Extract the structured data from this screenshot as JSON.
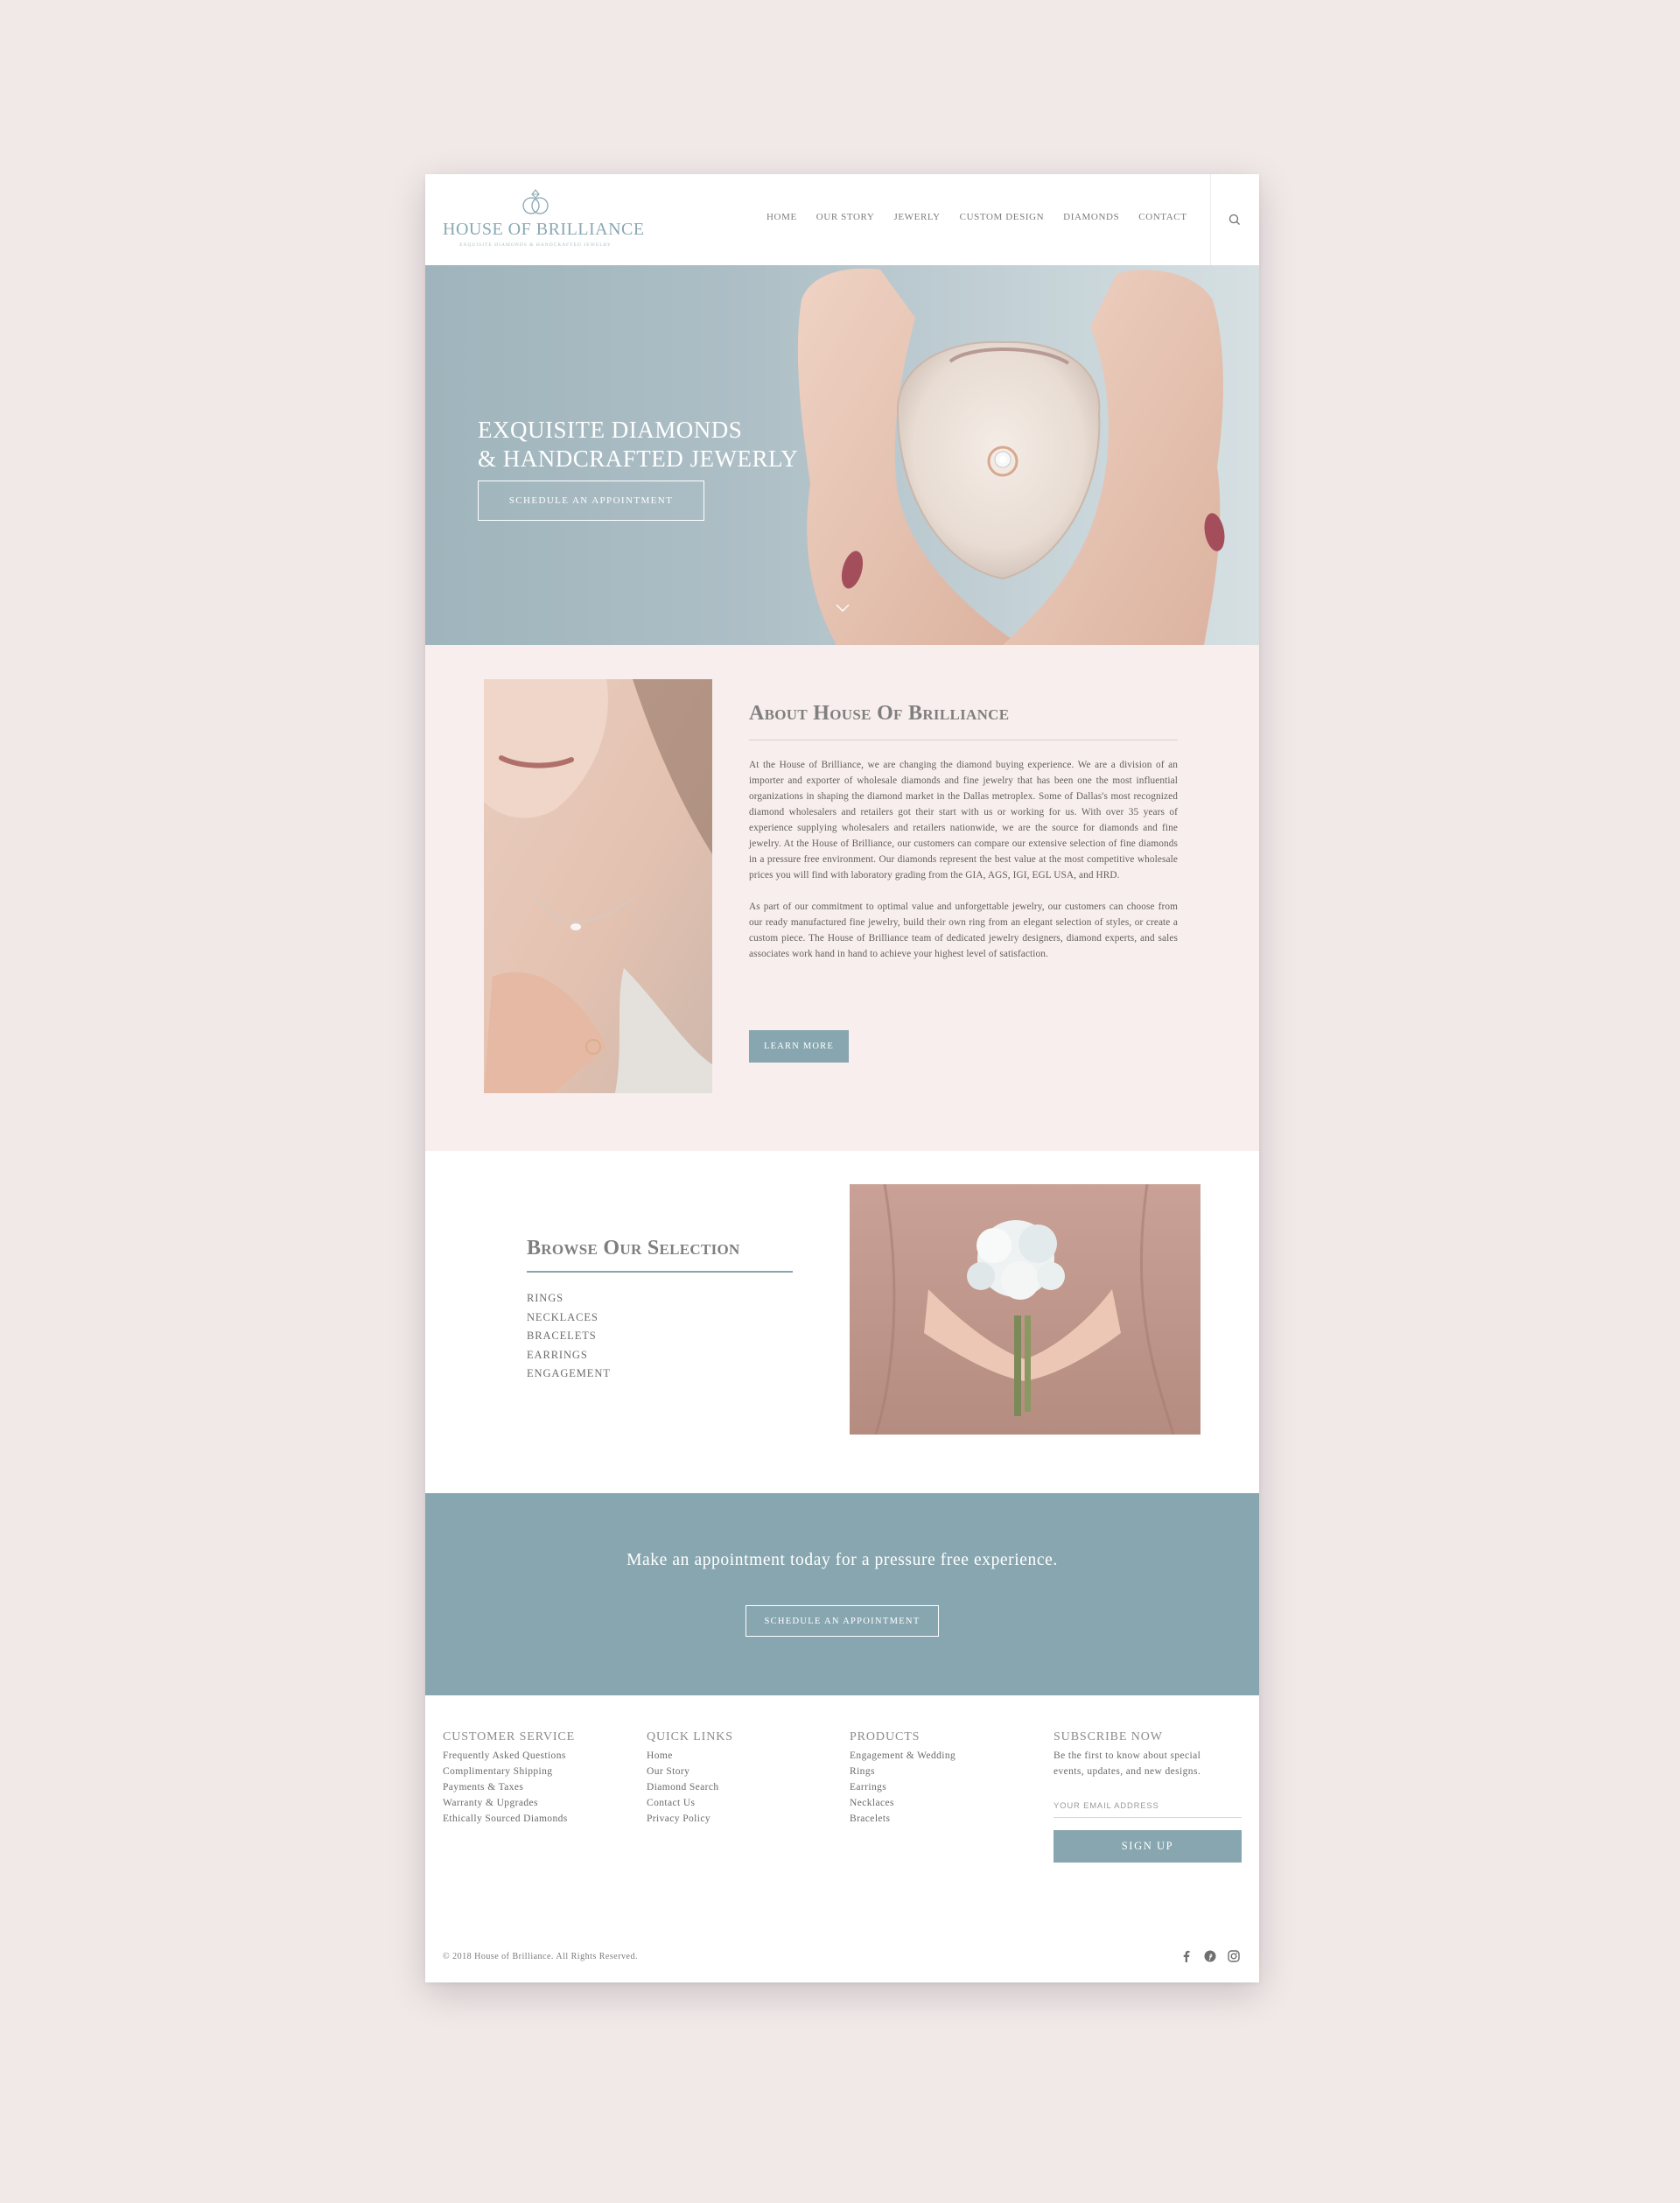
{
  "brand": {
    "name": "House of Brilliance",
    "tagline": "Exquisite Diamonds & Handcrafted Jewelry",
    "accent_color": "#87a6b0",
    "blush_color": "#f8eeed"
  },
  "nav": {
    "items": [
      "HOME",
      "OUR STORY",
      "JEWERLY",
      "CUSTOM DESIGN",
      "DIAMONDS",
      "CONTACT"
    ],
    "search_icon": "search-icon"
  },
  "hero": {
    "title_line1": "Exquisite Diamonds",
    "title_line2": "& Handcrafted Jewerly",
    "button": "Schedule an Appointment",
    "scroll_icon": "chevron-down-icon"
  },
  "about": {
    "title": "About House Of Brilliance",
    "paragraph1": "At the House of Brilliance, we are changing the diamond buying experience. We are a division of an importer and exporter of wholesale diamonds and fine jewelry that has been one the most influential organizations in shaping the diamond market in the Dallas metroplex. Some of Dallas's most recognized diamond wholesalers and retailers got their start with us or working for us. With over 35 years of experience supplying wholesalers and retailers nationwide, we are the source for diamonds and fine jewelry. At the House of Brilliance, our customers can compare our extensive selection of fine diamonds in a pressure free environment. Our diamonds represent the best value at the most competitive wholesale prices you will find with laboratory grading from the GIA, AGS, IGI, EGL USA, and HRD.",
    "paragraph2": "As part of our commitment to optimal value and unforgettable jewelry, our customers can choose from our ready manufactured fine jewelry, build their own ring from an elegant selection of styles, or create a custom piece. The House of Brilliance team of dedicated jewelry designers, diamond experts, and sales associates work hand in hand to achieve your highest level of satisfaction.",
    "button": "Learn More"
  },
  "browse": {
    "title": "Browse Our Selection",
    "items": [
      "Rings",
      "Necklaces",
      "Bracelets",
      "Earrings",
      "Engagement"
    ]
  },
  "cta": {
    "text": "Make an appointment today for a pressure free experience.",
    "button": "Schedule an Appointment"
  },
  "footer": {
    "customer_service": {
      "title": "Customer Service",
      "links": [
        "Frequently Asked Questions",
        "Complimentary Shipping",
        "Payments & Taxes",
        "Warranty & Upgrades",
        "Ethically Sourced Diamonds"
      ]
    },
    "quick_links": {
      "title": "Quick Links",
      "links": [
        "Home",
        "Our Story",
        "Diamond Search",
        "Contact Us",
        "Privacy Policy"
      ]
    },
    "products": {
      "title": "Products",
      "links": [
        "Engagement & Wedding",
        "Rings",
        "Earrings",
        "Necklaces",
        "Bracelets"
      ]
    },
    "subscribe": {
      "title": "Subscribe Now",
      "text_line1": "Be the first to know about special",
      "text_line2": "events, updates, and new designs.",
      "placeholder": "YOUR EMAIL ADDRESS",
      "button": "Sign Up"
    },
    "copyright": "© 2018 House of Brilliance. All Rights Reserved.",
    "socials": [
      "facebook-icon",
      "pinterest-icon",
      "instagram-icon"
    ]
  }
}
